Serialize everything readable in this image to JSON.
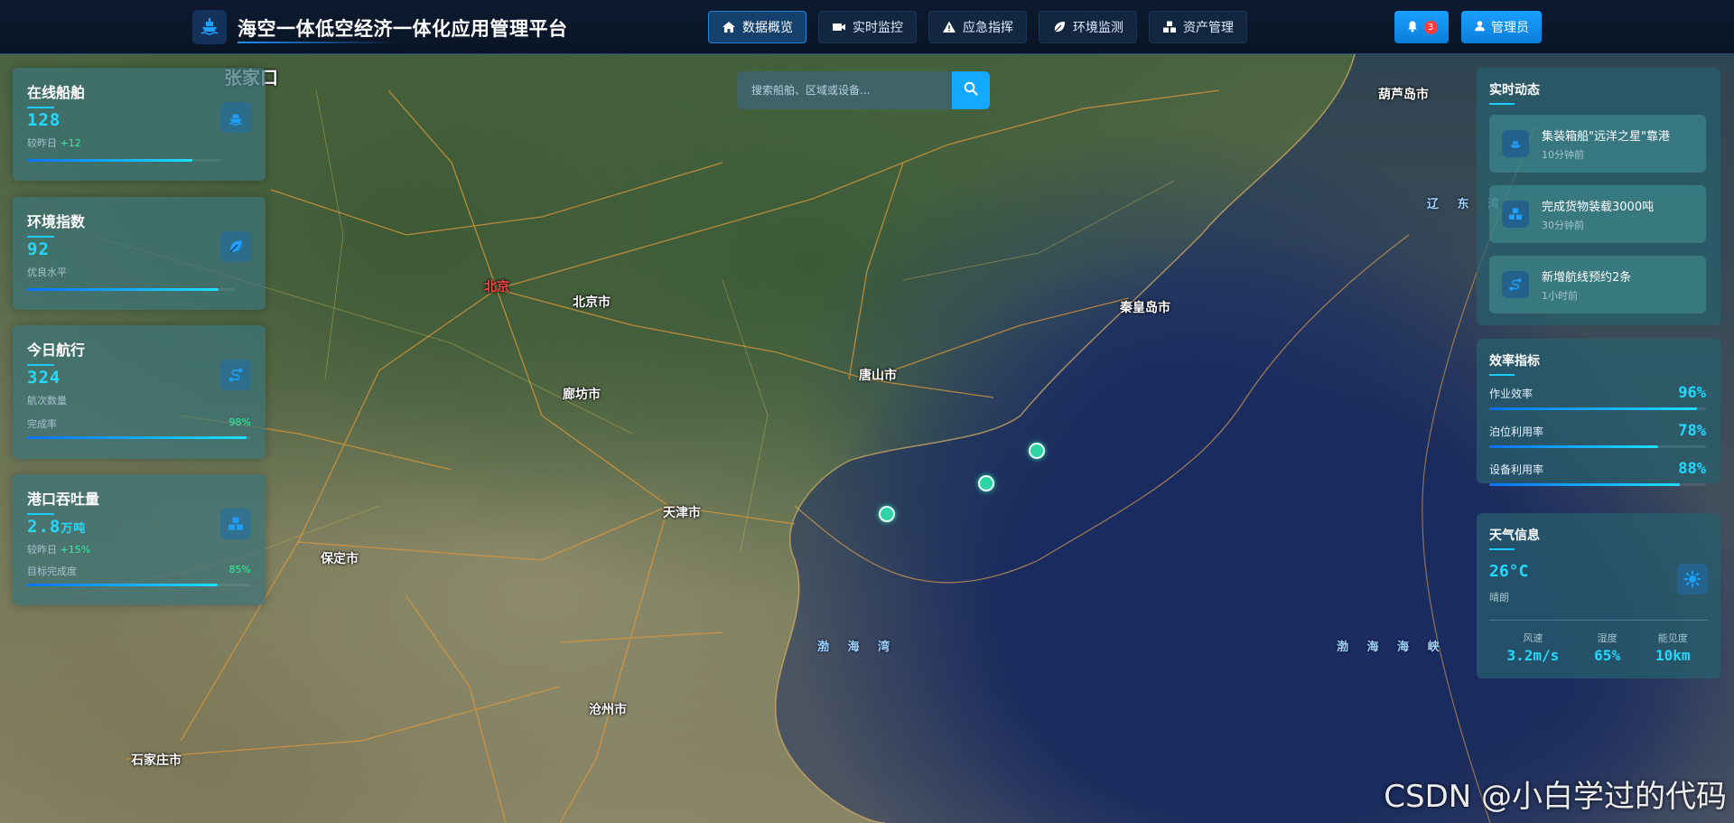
{
  "header": {
    "title": "海空一体低空经济一体化应用管理平台",
    "nav": [
      {
        "label": "数据概览",
        "icon": "home-icon",
        "active": true
      },
      {
        "label": "实时监控",
        "icon": "video-icon",
        "active": false
      },
      {
        "label": "应急指挥",
        "icon": "warning-icon",
        "active": false
      },
      {
        "label": "环境监测",
        "icon": "leaf-icon",
        "active": false
      },
      {
        "label": "资产管理",
        "icon": "boxes-icon",
        "active": false
      }
    ],
    "notification_count": "3",
    "user_label": "管理员"
  },
  "search": {
    "placeholder": "搜索船舶、区域或设备..."
  },
  "stats": [
    {
      "title": "在线船舶",
      "value": "128",
      "sub_prefix": "较昨日",
      "sub_change": "+12",
      "icon": "ship-icon",
      "progress": 0.85
    },
    {
      "title": "环境指数",
      "value": "92",
      "sub_text": "优良水平",
      "icon": "leaf-icon",
      "progress": 0.92
    },
    {
      "title": "今日航行",
      "value": "324",
      "sub_text": "航次数量",
      "row_label": "完成率",
      "row_value": "98%",
      "icon": "route-icon",
      "progress": 0.98
    },
    {
      "title": "港口吞吐量",
      "value": "2.8",
      "unit": "万吨",
      "sub_prefix": "较昨日",
      "sub_change": "+15%",
      "row_label": "目标完成度",
      "row_value": "85%",
      "icon": "cargo-icon",
      "progress": 0.85
    }
  ],
  "realtime": {
    "title": "实时动态",
    "events": [
      {
        "title": "集装箱船\"远洋之星\"靠港",
        "time": "10分钟前",
        "icon": "ship-icon"
      },
      {
        "title": "完成货物装载3000吨",
        "time": "30分钟前",
        "icon": "cargo-icon"
      },
      {
        "title": "新增航线预约2条",
        "time": "1小时前",
        "icon": "route-icon"
      }
    ]
  },
  "efficiency": {
    "title": "效率指标",
    "metrics": [
      {
        "label": "作业效率",
        "value": "96%",
        "progress": 0.96
      },
      {
        "label": "泊位利用率",
        "value": "78%",
        "progress": 0.78
      },
      {
        "label": "设备利用率",
        "value": "88%",
        "progress": 0.88
      }
    ]
  },
  "weather": {
    "title": "天气信息",
    "temperature": "26°C",
    "condition": "晴朗",
    "stats": [
      {
        "label": "风速",
        "value": "3.2m/s"
      },
      {
        "label": "湿度",
        "value": "65%"
      },
      {
        "label": "能见度",
        "value": "10km"
      }
    ]
  },
  "map": {
    "cities": [
      {
        "name": "北京",
        "capital": true
      },
      {
        "name": "北京市"
      },
      {
        "name": "天津市"
      },
      {
        "name": "唐山市"
      },
      {
        "name": "廊坊市"
      },
      {
        "name": "保定市"
      },
      {
        "name": "沧州市"
      },
      {
        "name": "石家庄市"
      },
      {
        "name": "秦皇岛市"
      },
      {
        "name": "葫芦岛市"
      },
      {
        "name": "张家口"
      }
    ],
    "sea_labels": [
      "渤 海 湾",
      "渤 海 海 峡",
      "辽 东 湾"
    ],
    "watermark": "CSDN @小白学过的代码"
  }
}
